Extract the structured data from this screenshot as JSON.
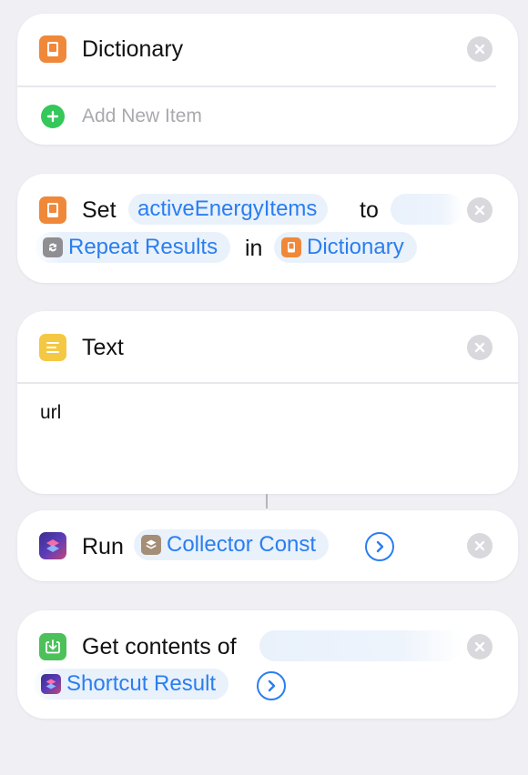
{
  "dictionary_card": {
    "title": "Dictionary",
    "icon": "book-icon",
    "add_item_label": "Add New Item"
  },
  "set_card": {
    "verb": "Set",
    "variable": "activeEnergyItems",
    "to_word": "to",
    "repeat_results": "Repeat Results",
    "in_word": "in",
    "dictionary_ref": "Dictionary"
  },
  "text_card": {
    "title": "Text",
    "icon": "text-lines-icon",
    "content": "url"
  },
  "run_card": {
    "verb": "Run",
    "shortcut": "Collector Const",
    "icon": "shortcuts-icon"
  },
  "get_contents_card": {
    "label": "Get contents of",
    "shortcut_result": "Shortcut Result",
    "icon": "download-icon"
  },
  "colors": {
    "accent": "#2a7ef0",
    "dictionary_orange": "#f0883a",
    "text_yellow": "#f5c843",
    "download_green": "#4cc15a",
    "background": "#efeff4"
  }
}
